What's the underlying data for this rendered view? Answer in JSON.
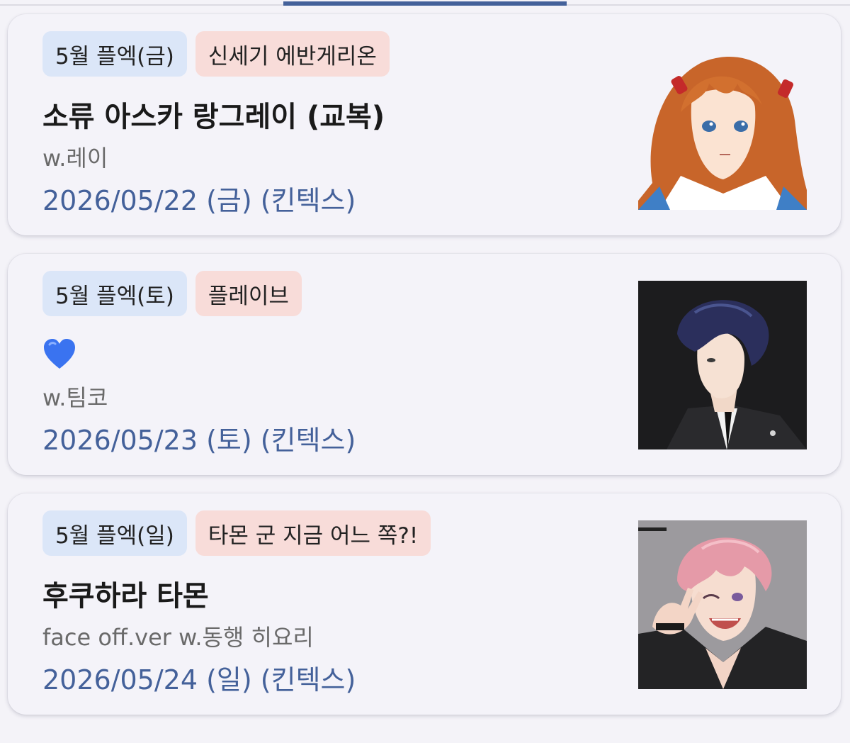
{
  "cards": [
    {
      "event_tag": "5월 플엑(금)",
      "series_tag": "신세기 에반게리온",
      "title": "소류 아스카 랑그레이 (교복)",
      "credit": "w.레이",
      "date": "2026/05/22 (금) (킨텍스)",
      "thumbnail": "anime-girl-orange-hair-portrait"
    },
    {
      "event_tag": "5월 플엑(토)",
      "series_tag": "플레이브",
      "title_emoji": "blue-heart-icon",
      "credit": "w.팀코",
      "date": "2026/05/23 (토) (킨텍스)",
      "thumbnail": "navy-hair-man-in-suit-portrait"
    },
    {
      "event_tag": "5월 플엑(일)",
      "series_tag": "타몬 군 지금 어느 쪽?!",
      "title": "후쿠하라 타몬",
      "credit": "face off.ver  w.동행 히요리",
      "date": "2026/05/24 (일) (킨텍스)",
      "thumbnail": "pink-hair-man-winking-portrait"
    }
  ],
  "colors": {
    "event_tag_bg": "#dbe6f8",
    "series_tag_bg": "#f8dcd9",
    "date_text": "#44619a",
    "tab_indicator": "#44619a"
  }
}
